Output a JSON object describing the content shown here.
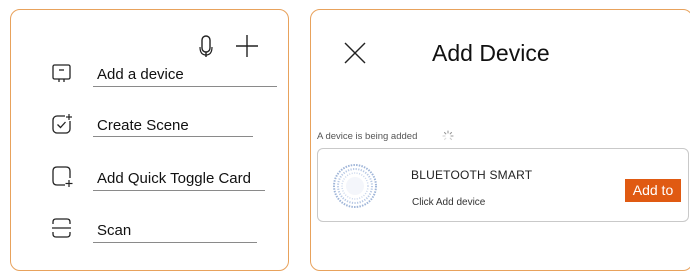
{
  "left_panel": {
    "top_icons": [
      "microphone-icon",
      "plus-icon"
    ],
    "menu": [
      {
        "label": "Add a device",
        "icon": "device-frame-icon"
      },
      {
        "label": "Create Scene",
        "icon": "scene-check-icon"
      },
      {
        "label": "Add Quick Toggle Card",
        "icon": "quick-toggle-card-icon"
      },
      {
        "label": "Scan",
        "icon": "scan-icon"
      }
    ]
  },
  "right_panel": {
    "close_icon": "close-icon",
    "title": "Add Device",
    "status": "A device is being added",
    "device": {
      "name": "BLUETOOTH SMART",
      "hint": "Click Add device",
      "button_label": "Add to",
      "button_color": "#e05a12"
    }
  },
  "colors": {
    "panel_border": "#e8a25c",
    "accent": "#e05a12"
  }
}
